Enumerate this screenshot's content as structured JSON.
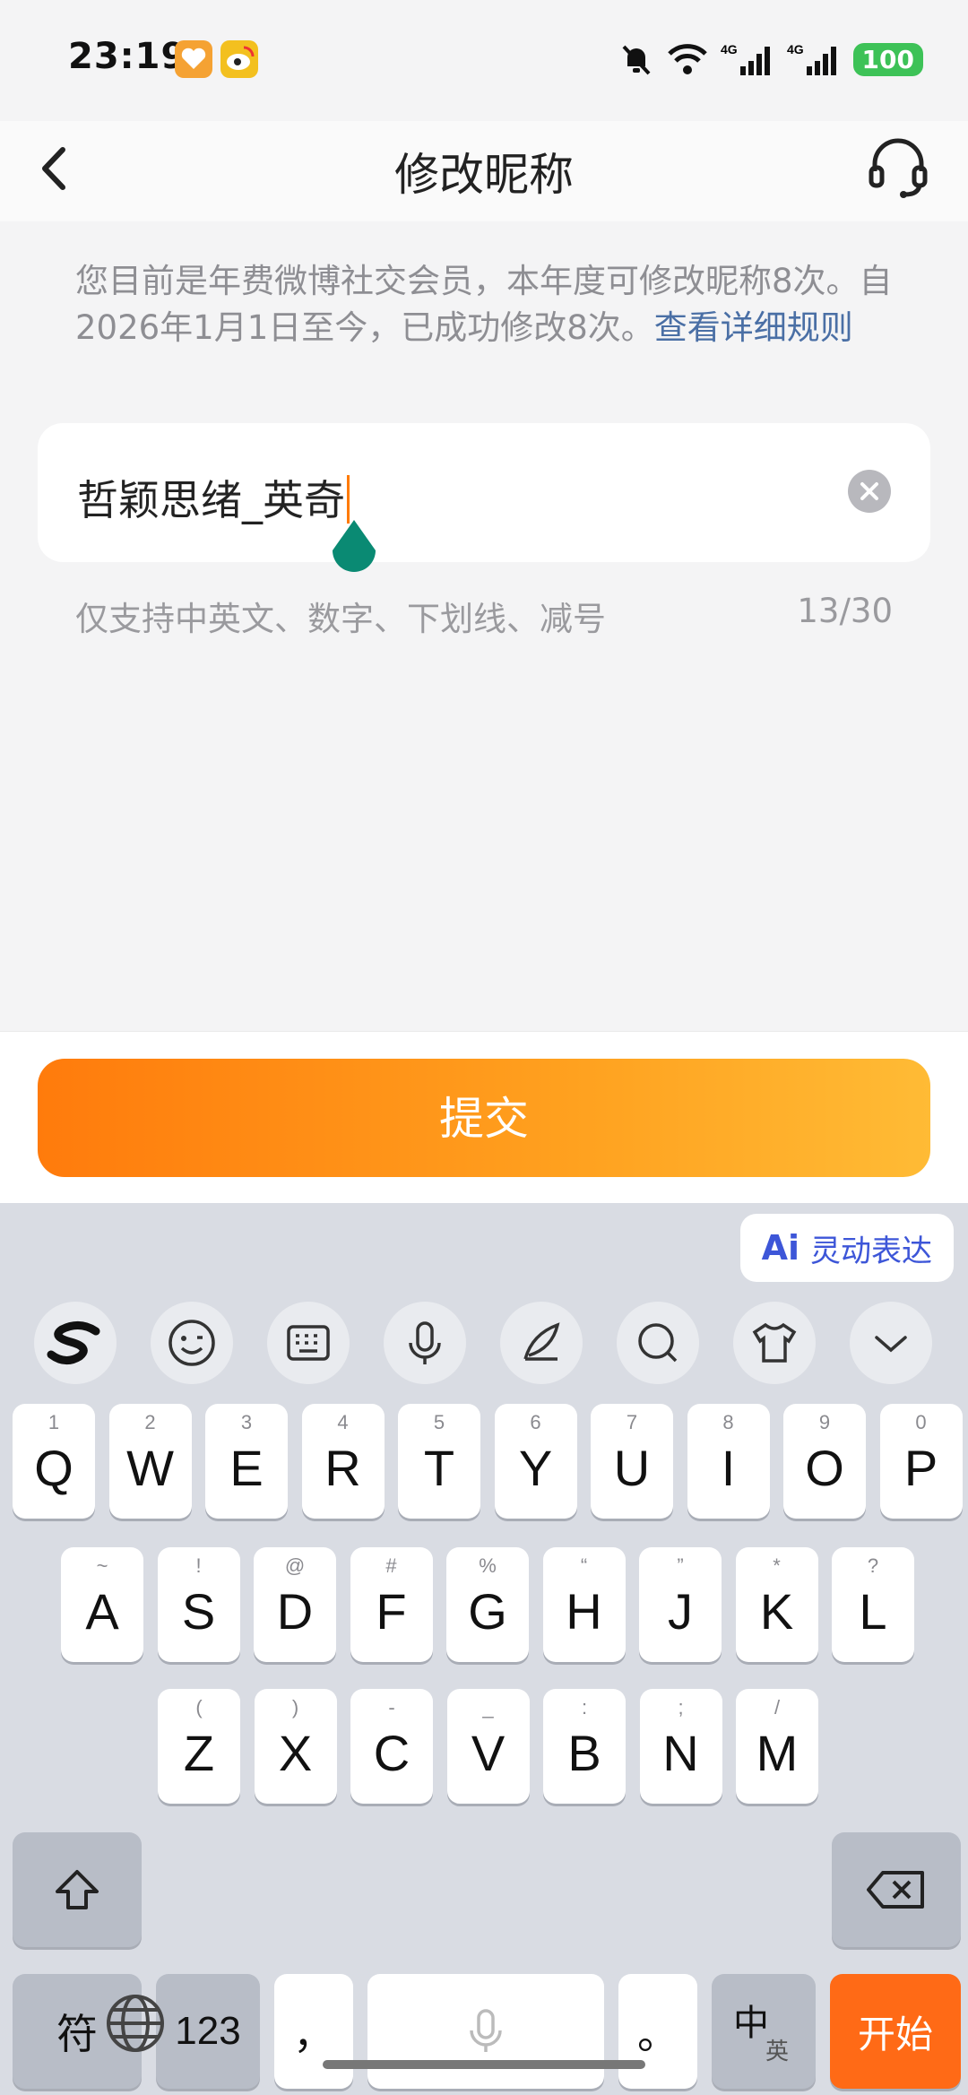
{
  "status_bar": {
    "time": "23:19",
    "battery": "100",
    "network": "4G"
  },
  "header": {
    "title": "修改昵称"
  },
  "info": {
    "text": "您目前是年费微博社交会员，本年度可修改昵称8次。自2026年1月1日至今，已成功修改8次。",
    "link": "查看详细规则"
  },
  "input": {
    "value": "哲颖思绪_英奇"
  },
  "hint": {
    "text": "仅支持中英文、数字、下划线、减号",
    "count": "13/30"
  },
  "submit_label": "提交",
  "keyboard": {
    "ai_label": "灵动表达",
    "ai_badge": "Ai",
    "row1": [
      {
        "k": "Q",
        "s": "1"
      },
      {
        "k": "W",
        "s": "2"
      },
      {
        "k": "E",
        "s": "3"
      },
      {
        "k": "R",
        "s": "4"
      },
      {
        "k": "T",
        "s": "5"
      },
      {
        "k": "Y",
        "s": "6"
      },
      {
        "k": "U",
        "s": "7"
      },
      {
        "k": "I",
        "s": "8"
      },
      {
        "k": "O",
        "s": "9"
      },
      {
        "k": "P",
        "s": "0"
      }
    ],
    "row2": [
      {
        "k": "A",
        "s": "~"
      },
      {
        "k": "S",
        "s": "!"
      },
      {
        "k": "D",
        "s": "@"
      },
      {
        "k": "F",
        "s": "#"
      },
      {
        "k": "G",
        "s": "%"
      },
      {
        "k": "H",
        "s": "“"
      },
      {
        "k": "J",
        "s": "”"
      },
      {
        "k": "K",
        "s": "*"
      },
      {
        "k": "L",
        "s": "?"
      }
    ],
    "row3": [
      {
        "k": "Z",
        "s": "("
      },
      {
        "k": "X",
        "s": ")"
      },
      {
        "k": "C",
        "s": "-"
      },
      {
        "k": "V",
        "s": "_"
      },
      {
        "k": "B",
        "s": ":"
      },
      {
        "k": "N",
        "s": ";"
      },
      {
        "k": "M",
        "s": "/"
      }
    ],
    "symbols": "符",
    "numbers": "123",
    "comma": "，",
    "period": "。",
    "lang_main": "中",
    "lang_sub": "英",
    "go": "开始"
  },
  "colors": {
    "accent": "#ff7b0c",
    "link": "#4a6fa5",
    "go_key": "#ff6a16",
    "cursor_handle": "#0a8a73"
  }
}
